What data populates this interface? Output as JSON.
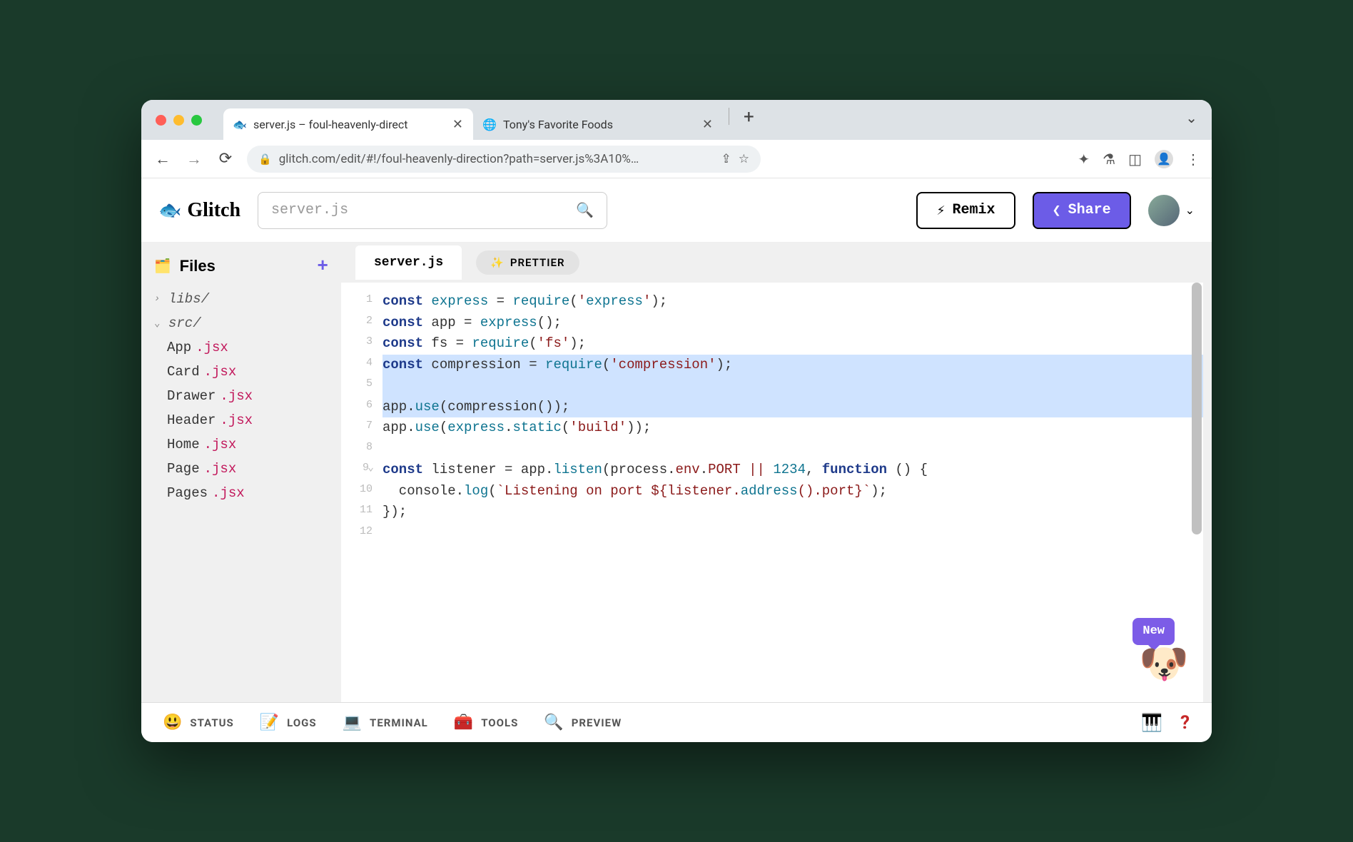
{
  "browser": {
    "tabs": [
      {
        "title": "server.js – foul-heavenly-direct",
        "favicon": "🐟",
        "active": true
      },
      {
        "title": "Tony's Favorite Foods",
        "favicon": "🌐",
        "active": false
      }
    ],
    "url": "glitch.com/edit/#!/foul-heavenly-direction?path=server.js%3A10%…"
  },
  "glitch": {
    "brand": "Glitch",
    "search_placeholder": "server.js",
    "remix_label": "Remix",
    "share_label": "Share"
  },
  "sidebar": {
    "title": "Files",
    "folders": [
      {
        "name": "libs/",
        "open": false
      },
      {
        "name": "src/",
        "open": true
      }
    ],
    "files": [
      {
        "base": "App",
        "ext": ".jsx"
      },
      {
        "base": "Card",
        "ext": ".jsx"
      },
      {
        "base": "Drawer",
        "ext": ".jsx"
      },
      {
        "base": "Header",
        "ext": ".jsx"
      },
      {
        "base": "Home",
        "ext": ".jsx"
      },
      {
        "base": "Page",
        "ext": ".jsx"
      },
      {
        "base": "Pages",
        "ext": ".jsx"
      }
    ]
  },
  "editor": {
    "active_tab": "server.js",
    "prettier_label": "PRETTIER",
    "highlighted_lines": [
      4,
      5,
      6
    ],
    "lines": [
      "const express = require('express');",
      "const app = express();",
      "const fs = require('fs');",
      "const compression = require('compression');",
      "",
      "app.use(compression());",
      "app.use(express.static('build'));",
      "",
      "const listener = app.listen(process.env.PORT || 1234, function () {",
      "  console.log(`Listening on port ${listener.address().port}`);",
      "});",
      ""
    ]
  },
  "badge": {
    "text": "New"
  },
  "bottombar": {
    "items": [
      {
        "icon": "😃",
        "label": "STATUS"
      },
      {
        "icon": "📝",
        "label": "LOGS"
      },
      {
        "icon": "💻",
        "label": "TERMINAL"
      },
      {
        "icon": "🧰",
        "label": "TOOLS"
      },
      {
        "icon": "🔍",
        "label": "PREVIEW"
      }
    ]
  }
}
